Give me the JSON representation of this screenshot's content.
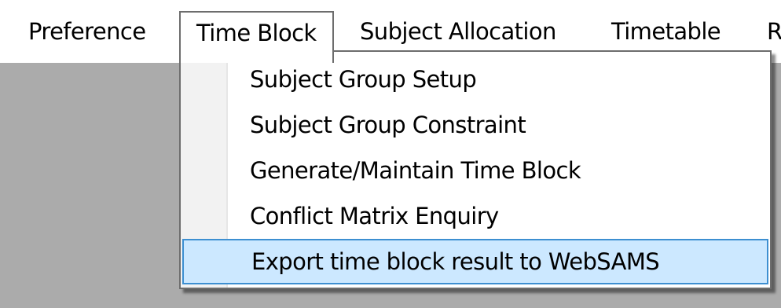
{
  "menubar": {
    "items": [
      {
        "label": "Preference",
        "open": false
      },
      {
        "label": "Time Block",
        "open": true
      },
      {
        "label": "Subject Allocation",
        "open": false
      },
      {
        "label": "Timetable",
        "open": false
      },
      {
        "label": "R",
        "open": false
      }
    ]
  },
  "dropdown": {
    "items": [
      {
        "label": "Subject Group Setup",
        "highlighted": false
      },
      {
        "label": "Subject Group Constraint",
        "highlighted": false
      },
      {
        "label": "Generate/Maintain Time Block",
        "highlighted": false
      },
      {
        "label": "Conflict Matrix Enquiry",
        "highlighted": false
      },
      {
        "label": "Export time block result to WebSAMS",
        "highlighted": true
      }
    ]
  },
  "colors": {
    "menubar_background": "#ffffff",
    "workspace_background": "#ababab",
    "dropdown_border": "#6d6d6d",
    "highlight_fill": "#cce8ff",
    "highlight_border": "#3d8fd1"
  }
}
